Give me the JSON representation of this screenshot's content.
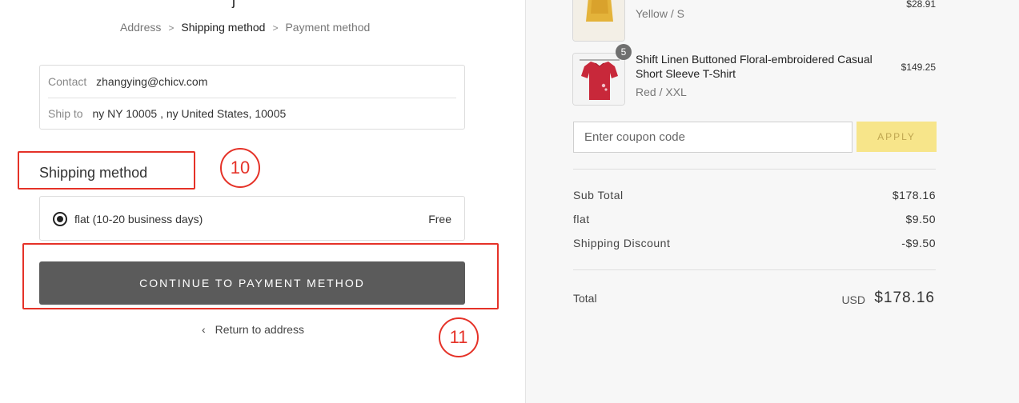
{
  "breadcrumb": {
    "items": [
      "Address",
      "Shipping method",
      "Payment method"
    ],
    "separator": ">"
  },
  "contact": {
    "contact_label": "Contact",
    "contact_value": "zhangying@chicv.com",
    "ship_label": "Ship to",
    "ship_value": "ny NY 10005 , ny United States, 10005"
  },
  "shipping": {
    "title": "Shipping method",
    "option_label": "flat (10-20 business days)",
    "option_price": "Free"
  },
  "actions": {
    "continue_label": "CONTINUE TO PAYMENT METHOD",
    "return_label": "Return to address"
  },
  "annotations": {
    "n10": "10",
    "n11": "11"
  },
  "cart": {
    "items": [
      {
        "name": "",
        "variant": "Yellow / S",
        "price": "$28.91",
        "thumb_color": "#e4b33a"
      },
      {
        "name": "Shift Linen Buttoned Floral-embroidered Casual Short Sleeve T-Shirt",
        "variant": "Red / XXL",
        "price": "$149.25",
        "quantity": "5",
        "thumb_color": "#c8283a"
      }
    ],
    "coupon_placeholder": "Enter coupon code",
    "apply_label": "APPLY"
  },
  "summary": {
    "subtotal_label": "Sub Total",
    "subtotal_value": "$178.16",
    "shipping_label": "flat",
    "shipping_value": "$9.50",
    "discount_label": "Shipping Discount",
    "discount_value": "-$9.50",
    "total_label": "Total",
    "total_currency": "USD",
    "total_value": "$178.16"
  },
  "colors": {
    "accent_annotation": "#e53228",
    "button_dark": "#5b5b5b",
    "apply_bg": "#f7e58a"
  }
}
